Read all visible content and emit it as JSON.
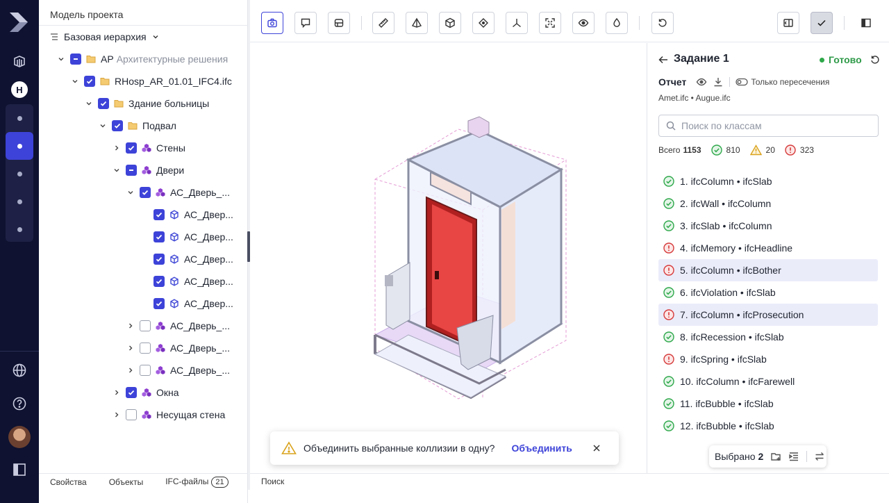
{
  "rail": {
    "logo": "app-logo",
    "project_avatar_letter": "H",
    "nav_dots": 5
  },
  "left_panel": {
    "title": "Модель проекта",
    "hierarchy_label": "Базовая иерархия",
    "tree": [
      {
        "label": "АР",
        "muted": "Архитектурные решения",
        "check": "partial",
        "icon": "folder",
        "chev": "down",
        "level": 0
      },
      {
        "label": "RHosp_AR_01.01_IFC4.ifc",
        "check": "on",
        "icon": "folder",
        "chev": "down",
        "level": 1
      },
      {
        "label": "Здание больницы",
        "check": "on",
        "icon": "folder",
        "chev": "down",
        "level": 2
      },
      {
        "label": "Подвал",
        "check": "on",
        "icon": "folder",
        "chev": "down",
        "level": 3
      },
      {
        "label": "Стены",
        "check": "on",
        "icon": "group",
        "chev": "right",
        "level": 4
      },
      {
        "label": "Двери",
        "check": "partial",
        "icon": "group",
        "chev": "down",
        "level": 4
      },
      {
        "label": "АС_Дверь_...",
        "check": "on",
        "icon": "group",
        "chev": "down",
        "level": 5
      },
      {
        "label": "АС_Двер...",
        "check": "on",
        "icon": "cube",
        "chev": "none",
        "level": 6
      },
      {
        "label": "АС_Двер...",
        "check": "on",
        "icon": "cube",
        "chev": "none",
        "level": 6
      },
      {
        "label": "АС_Двер...",
        "check": "on",
        "icon": "cube",
        "chev": "none",
        "level": 6
      },
      {
        "label": "АС_Двер...",
        "check": "on",
        "icon": "cube",
        "chev": "none",
        "level": 6
      },
      {
        "label": "АС_Двер...",
        "check": "on",
        "icon": "cube",
        "chev": "none",
        "level": 6
      },
      {
        "label": "АС_Дверь_...",
        "check": "off",
        "icon": "group",
        "chev": "right",
        "level": 5
      },
      {
        "label": "АС_Дверь_...",
        "check": "off",
        "icon": "group",
        "chev": "right",
        "level": 5
      },
      {
        "label": "АС_Дверь_...",
        "check": "off",
        "icon": "group",
        "chev": "right",
        "level": 5
      },
      {
        "label": "Окна",
        "check": "on",
        "icon": "group",
        "chev": "right",
        "level": 4
      },
      {
        "label": "Несущая стена",
        "check": "off",
        "icon": "group",
        "chev": "right",
        "level": 4
      }
    ],
    "footer": {
      "properties": "Свойства",
      "objects": "Объекты",
      "ifc_files": "IFC-файлы",
      "ifc_count": "21"
    }
  },
  "viewport": {
    "footer_search": "Поиск",
    "toast": {
      "text": "Объединить выбранные коллизии в одну?",
      "action": "Объединить"
    }
  },
  "toolbar": {
    "tools": [
      "camera-icon",
      "comment-icon",
      "section-box-icon",
      "ruler-icon",
      "pyramid-icon",
      "cube-icon",
      "diamond-icon",
      "axes-icon",
      "fit-view-icon",
      "eye-icon",
      "drop-icon",
      "reset-icon"
    ],
    "right_tools": [
      "compare-icon",
      "check-icon",
      "panel-icon"
    ]
  },
  "right_panel": {
    "title": "Задание 1",
    "status": "Готово",
    "status_color": "#2ea84a",
    "report_label": "Отчет",
    "only_intersections": "Только пересечения",
    "files": "Amet.ifc • Augue.ifc",
    "search_placeholder": "Поиск по классам",
    "stats": {
      "total_label": "Всего",
      "total": "1153",
      "ok": "810",
      "warn": "20",
      "error": "323"
    },
    "collisions": [
      {
        "label": "1. ifcColumn • ifcSlab",
        "status": "ok",
        "hl": false
      },
      {
        "label": "2. ifcWall • ifcColumn",
        "status": "ok",
        "hl": false
      },
      {
        "label": "3. ifcSlab • ifcColumn",
        "status": "ok",
        "hl": false
      },
      {
        "label": "4. ifcMemory • ifcHeadline",
        "status": "error",
        "hl": false
      },
      {
        "label": "5. ifcColumn • ifcBother",
        "status": "error",
        "hl": true
      },
      {
        "label": "6. ifcViolation • ifcSlab",
        "status": "ok",
        "hl": false
      },
      {
        "label": "7. ifcColumn • ifcProsecution",
        "status": "error",
        "hl": true
      },
      {
        "label": "8. ifcRecession • ifcSlab",
        "status": "ok",
        "hl": false
      },
      {
        "label": "9. ifcSpring • ifcSlab",
        "status": "error",
        "hl": false
      },
      {
        "label": "10. ifcColumn • ifcFarewell",
        "status": "ok",
        "hl": false
      },
      {
        "label": "11. ifcBubble • ifcSlab",
        "status": "ok",
        "hl": false
      },
      {
        "label": "12. ifcBubble • ifcSlab",
        "status": "ok",
        "hl": false
      }
    ],
    "selection": {
      "label": "Выбрано",
      "count": "2"
    }
  }
}
